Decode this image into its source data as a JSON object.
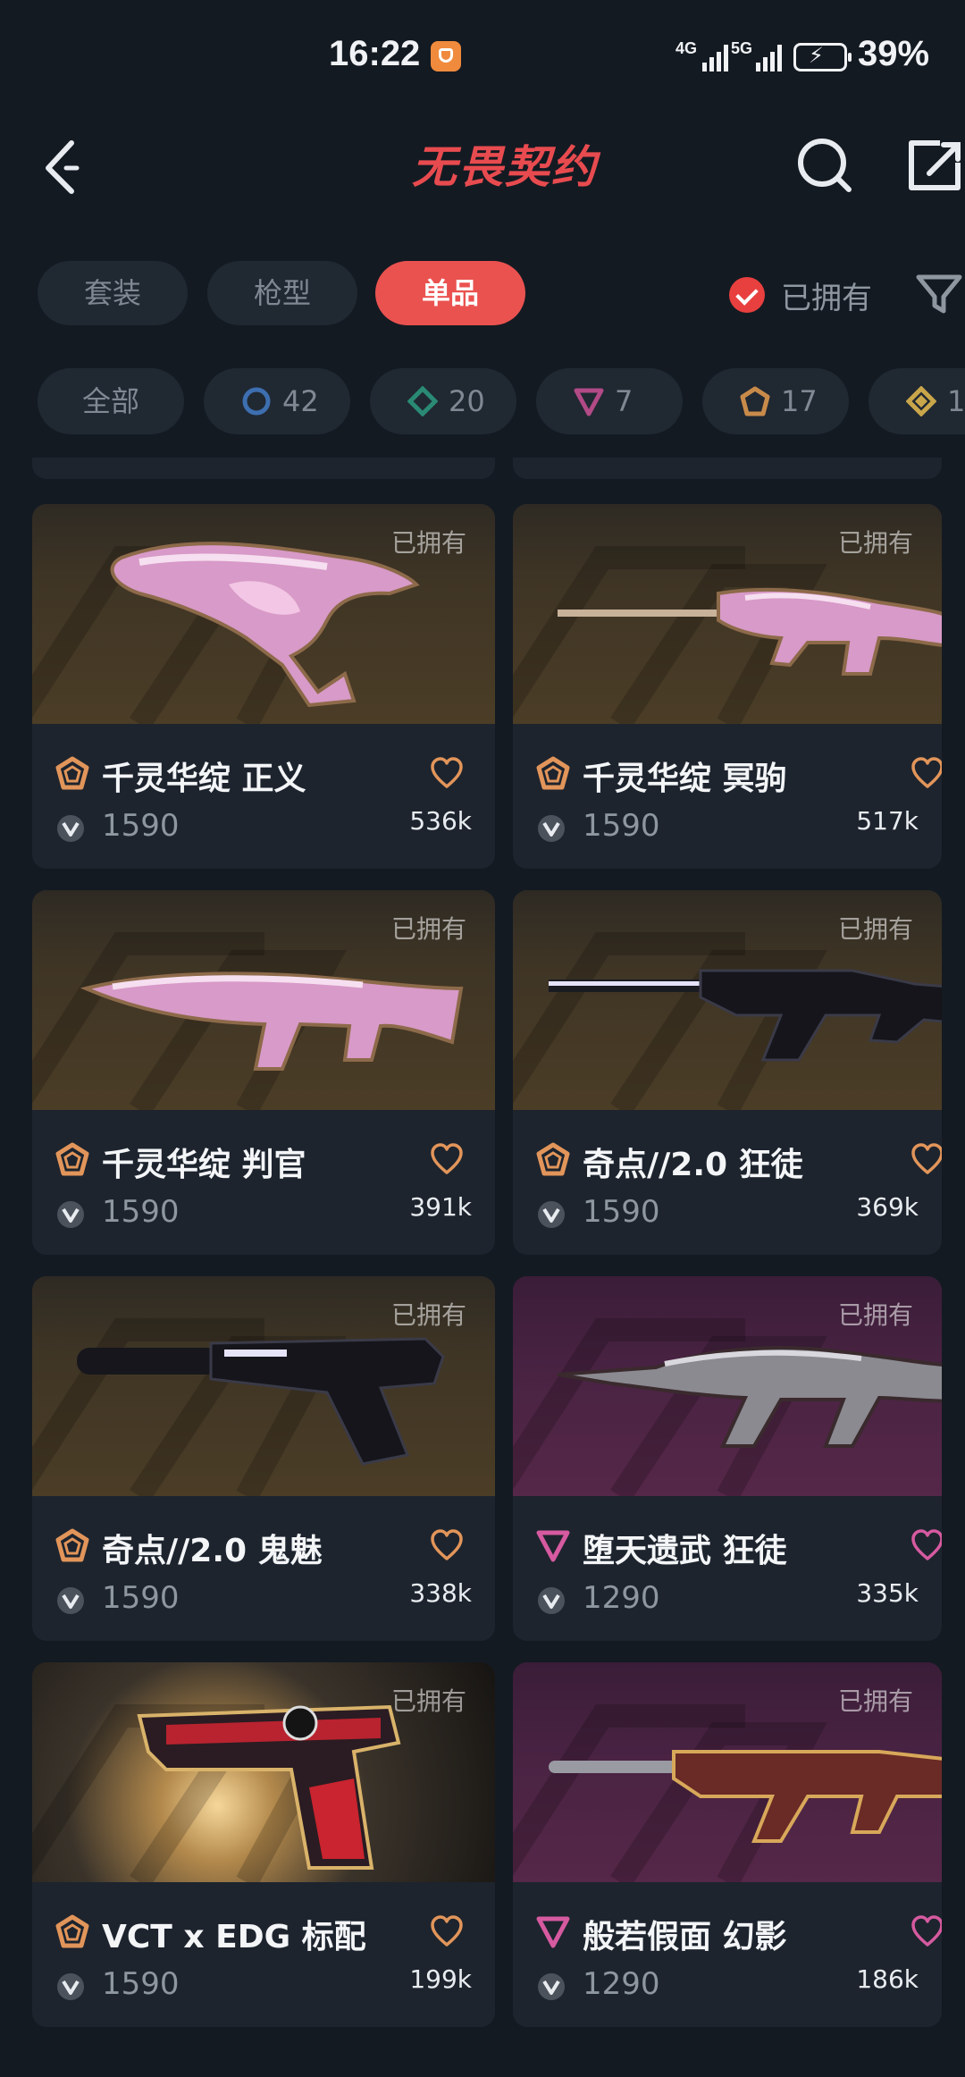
{
  "status_bar": {
    "time": "16:22",
    "network_1": "4G",
    "network_2": "5G",
    "battery": "39%"
  },
  "header": {
    "title": "无畏契约",
    "title_color": "#e84b4f"
  },
  "tabs": [
    {
      "label": "套装",
      "active": false
    },
    {
      "label": "枪型",
      "active": false
    },
    {
      "label": "单品",
      "active": true
    }
  ],
  "owned_filter": {
    "label": "已拥有",
    "checked": true
  },
  "rarity_filters": [
    {
      "label": "全部",
      "icon": "all"
    },
    {
      "label": "",
      "count": "42",
      "icon": "select-tier-icon",
      "color": "#3d6fb0"
    },
    {
      "label": "",
      "count": "20",
      "icon": "deluxe-tier-icon",
      "color": "#2a8a74"
    },
    {
      "label": "",
      "count": "7",
      "icon": "premium-tier-icon",
      "color": "#b14a86"
    },
    {
      "label": "",
      "count": "17",
      "icon": "exclusive-tier-icon",
      "color": "#c98b4a"
    },
    {
      "label": "",
      "count": "1",
      "icon": "ultra-tier-icon",
      "color": "#c9a64a"
    }
  ],
  "owned_tag": "已拥有",
  "skins": [
    {
      "name": "千灵华绽 正义",
      "price": "1590",
      "likes": "536k",
      "tier_color": "#e2955a",
      "bg": "gold",
      "gun": "pink-revolver"
    },
    {
      "name": "千灵华绽 冥驹",
      "price": "1590",
      "likes": "517k",
      "tier_color": "#e2955a",
      "bg": "gold",
      "gun": "pink-sniper"
    },
    {
      "name": "千灵华绽 判官",
      "price": "1590",
      "likes": "391k",
      "tier_color": "#e2955a",
      "bg": "gold",
      "gun": "pink-shotgun"
    },
    {
      "name": "奇点//2.0 狂徒",
      "price": "1590",
      "likes": "369k",
      "tier_color": "#e2955a",
      "bg": "gold",
      "gun": "dark-rifle"
    },
    {
      "name": "奇点//2.0 鬼魅",
      "price": "1590",
      "likes": "338k",
      "tier_color": "#e2955a",
      "bg": "gold",
      "gun": "dark-pistol"
    },
    {
      "name": "堕天遗武 狂徒",
      "price": "1290",
      "likes": "335k",
      "tier_color": "#d65aa0",
      "bg": "purple",
      "gun": "silver-rifle"
    },
    {
      "name": "VCT x EDG 标配",
      "price": "1590",
      "likes": "199k",
      "tier_color": "#e2955a",
      "bg": "edg",
      "gun": "red-pistol"
    },
    {
      "name": "般若假面 幻影",
      "price": "1290",
      "likes": "186k",
      "tier_color": "#d65aa0",
      "bg": "purple",
      "gun": "copper-rifle"
    }
  ]
}
